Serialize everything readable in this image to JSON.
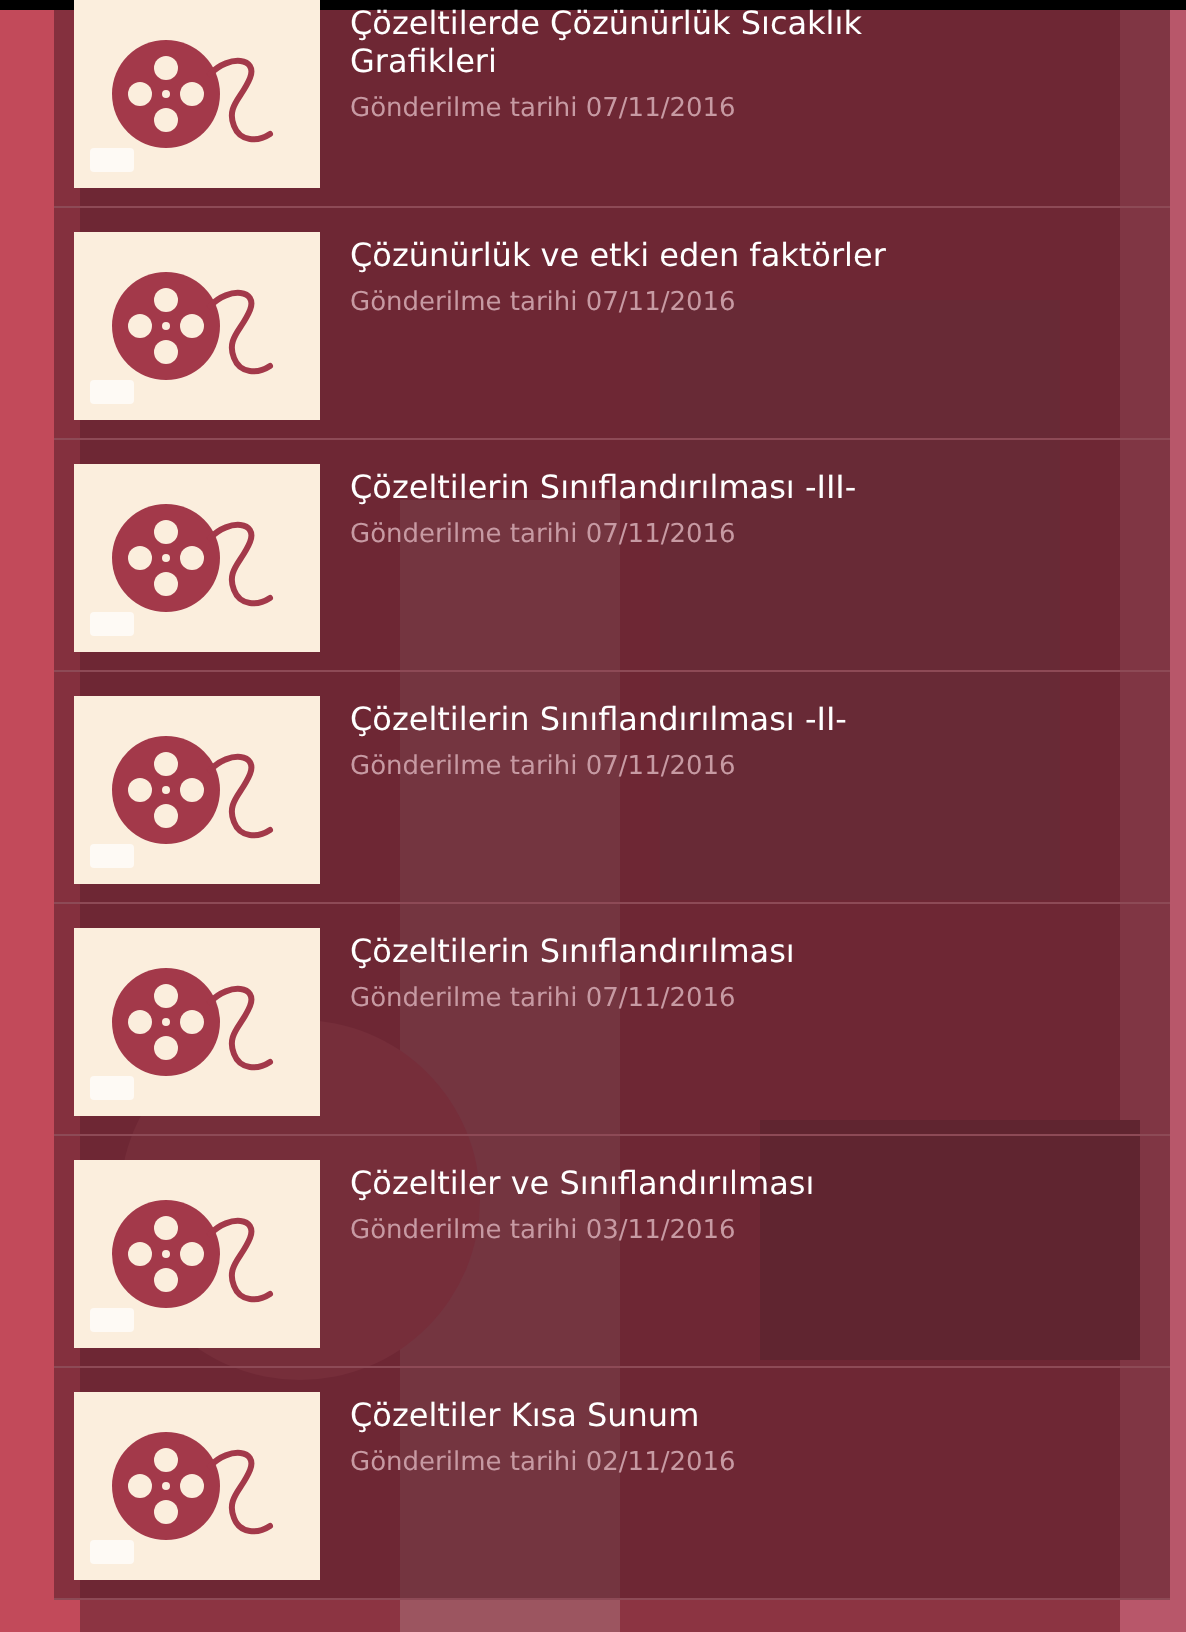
{
  "items": [
    {
      "title": "Çözeltilerde Çözünürlük Sıcaklık Grafikleri",
      "date": "Gönderilme tarihi 07/11/2016"
    },
    {
      "title": "Çözünürlük ve etki eden faktörler",
      "date": "Gönderilme tarihi 07/11/2016"
    },
    {
      "title": "Çözeltilerin Sınıflandırılması -III-",
      "date": "Gönderilme tarihi 07/11/2016"
    },
    {
      "title": "Çözeltilerin Sınıflandırılması -II-",
      "date": "Gönderilme tarihi 07/11/2016"
    },
    {
      "title": "Çözeltilerin Sınıflandırılması",
      "date": "Gönderilme tarihi 07/11/2016"
    },
    {
      "title": "Çözeltiler ve Sınıflandırılması",
      "date": "Gönderilme tarihi 03/11/2016"
    },
    {
      "title": "Çözeltiler Kısa Sunum",
      "date": "Gönderilme tarihi 02/11/2016"
    }
  ]
}
